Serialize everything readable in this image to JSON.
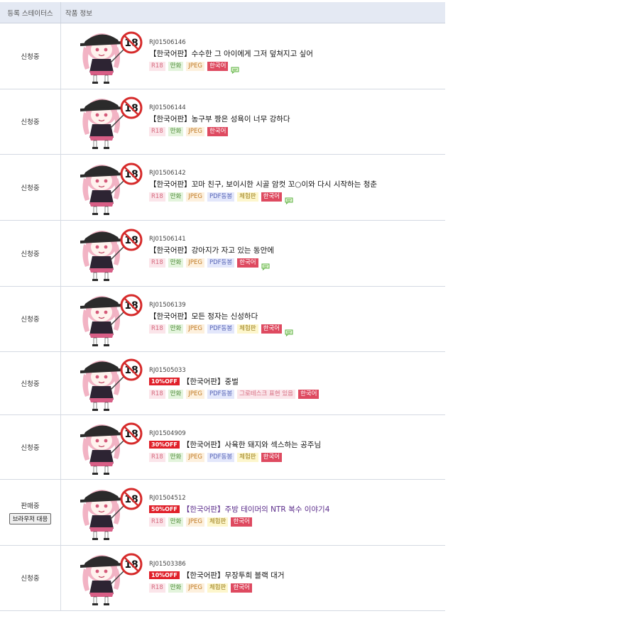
{
  "header": {
    "col_status": "등록 스테이터스",
    "col_info": "작품 정보"
  },
  "browser_button": "브라우저 대응",
  "rows": [
    {
      "status": "신청중",
      "id": "RJ01506146",
      "discount": "",
      "title": "【한국어판】수수한 그 아이에게 그저 덮쳐지고 싶어",
      "tags": [
        "R18",
        "만화",
        "JPEG",
        "한국어"
      ],
      "kinds": [
        "r18",
        "manga",
        "jpeg",
        "korean"
      ],
      "chat": true,
      "purple": false,
      "button": false
    },
    {
      "status": "신청중",
      "id": "RJ01506144",
      "discount": "",
      "title": "【한국어판】농구부 짱은 성욕이 너무 강하다",
      "tags": [
        "R18",
        "만화",
        "JPEG",
        "한국어"
      ],
      "kinds": [
        "r18",
        "manga",
        "jpeg",
        "korean"
      ],
      "chat": false,
      "purple": false,
      "button": false
    },
    {
      "status": "신청중",
      "id": "RJ01506142",
      "discount": "",
      "title": "【한국어판】꼬마 친구, 보이시한 시골 암컷 꼬○이와 다시 시작하는 청춘",
      "tags": [
        "R18",
        "만화",
        "JPEG",
        "PDF동봉",
        "체험판",
        "한국어"
      ],
      "kinds": [
        "r18",
        "manga",
        "jpeg",
        "pdf",
        "trial",
        "korean"
      ],
      "chat": true,
      "purple": false,
      "button": false
    },
    {
      "status": "신청중",
      "id": "RJ01506141",
      "discount": "",
      "title": "【한국어판】강아지가 자고 있는 동안에",
      "tags": [
        "R18",
        "만화",
        "JPEG",
        "PDF동봉",
        "한국어"
      ],
      "kinds": [
        "r18",
        "manga",
        "jpeg",
        "pdf",
        "korean"
      ],
      "chat": true,
      "purple": false,
      "button": false
    },
    {
      "status": "신청중",
      "id": "RJ01506139",
      "discount": "",
      "title": "【한국어판】모든 정자는 신성하다",
      "tags": [
        "R18",
        "만화",
        "JPEG",
        "PDF동봉",
        "체험판",
        "한국어"
      ],
      "kinds": [
        "r18",
        "manga",
        "jpeg",
        "pdf",
        "trial",
        "korean"
      ],
      "chat": true,
      "purple": false,
      "button": false
    },
    {
      "status": "신청중",
      "id": "RJ01505033",
      "discount": "10%OFF",
      "title": "【한국어판】중벌",
      "tags": [
        "R18",
        "만화",
        "JPEG",
        "PDF동봉",
        "그로테스크 표현 있음",
        "한국어"
      ],
      "kinds": [
        "r18",
        "manga",
        "jpeg",
        "pdf",
        "grotesque",
        "korean"
      ],
      "chat": false,
      "purple": false,
      "button": false
    },
    {
      "status": "신청중",
      "id": "RJ01504909",
      "discount": "30%OFF",
      "title": "【한국어판】사육한 돼지와 섹스하는 공주님",
      "tags": [
        "R18",
        "만화",
        "JPEG",
        "PDF동봉",
        "체험판",
        "한국어"
      ],
      "kinds": [
        "r18",
        "manga",
        "jpeg",
        "pdf",
        "trial",
        "korean"
      ],
      "chat": false,
      "purple": false,
      "button": false
    },
    {
      "status": "판매중",
      "id": "RJ01504512",
      "discount": "50%OFF",
      "title": "【한국어판】주방 테이머의 NTR 복수 이야기4",
      "tags": [
        "R18",
        "만화",
        "JPEG",
        "체험판",
        "한국어"
      ],
      "kinds": [
        "r18",
        "manga",
        "jpeg",
        "trial",
        "korean"
      ],
      "chat": false,
      "purple": true,
      "button": true
    },
    {
      "status": "신청중",
      "id": "RJ01503386",
      "discount": "10%OFF",
      "title": "【한국어판】무장투희 블랙 대거",
      "tags": [
        "R18",
        "만화",
        "JPEG",
        "체험판",
        "한국어"
      ],
      "kinds": [
        "r18",
        "manga",
        "jpeg",
        "trial",
        "korean"
      ],
      "chat": false,
      "purple": false,
      "button": false
    }
  ],
  "thumbnail": {
    "icon": "age-restricted-18-placeholder",
    "badge": "18",
    "colors": {
      "badge_red": "#d62b2b",
      "hair": "#f2b3c4",
      "dress": "#2d2433",
      "hat": "#2b2b2b"
    }
  }
}
